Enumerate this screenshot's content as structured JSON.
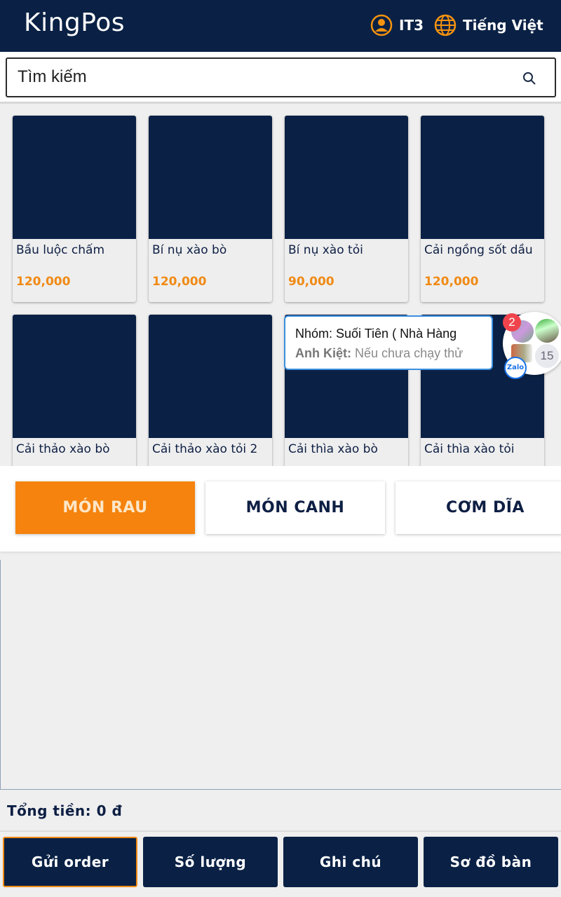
{
  "header": {
    "logo": "KingPos",
    "user_label": "IT3",
    "language_label": "Tiếng Việt"
  },
  "search": {
    "placeholder": "Tìm kiếm"
  },
  "products": [
    {
      "name": "Bầu luộc chấm",
      "price": "120,000"
    },
    {
      "name": "Bí nụ xào bò",
      "price": "120,000"
    },
    {
      "name": "Bí nụ xào tỏi",
      "price": "90,000"
    },
    {
      "name": "Cải ngồng sốt dầu",
      "price": "120,000"
    },
    {
      "name": "Cải thảo xào bò",
      "price": ""
    },
    {
      "name": "Cải thảo xào tỏi 2",
      "price": ""
    },
    {
      "name": "Cải thìa xào bò",
      "price": ""
    },
    {
      "name": "Cải thìa xào tỏi",
      "price": ""
    }
  ],
  "chat_popup": {
    "title": "Nhóm: Suối Tiên  ( Nhà Hàng",
    "sender": "Anh Kiệt:",
    "message": "Nếu chưa chạy thử",
    "unread_badge": "2",
    "member_count": "15",
    "app_label": "Zalo"
  },
  "categories": [
    {
      "label": "MÓN RAU",
      "active": true
    },
    {
      "label": "MÓN CANH",
      "active": false
    },
    {
      "label": "CƠM DĨA",
      "active": false
    }
  ],
  "order": {
    "total_label": "Tổng tiền:",
    "total_value": "0 đ"
  },
  "actions": {
    "send_order": "Gửi order",
    "quantity": "Số lượng",
    "note": "Ghi chú",
    "table_map": "Sơ đồ bàn"
  },
  "colors": {
    "header_bg": "#0a2145",
    "accent": "#f5830d",
    "price": "#f08a14"
  }
}
